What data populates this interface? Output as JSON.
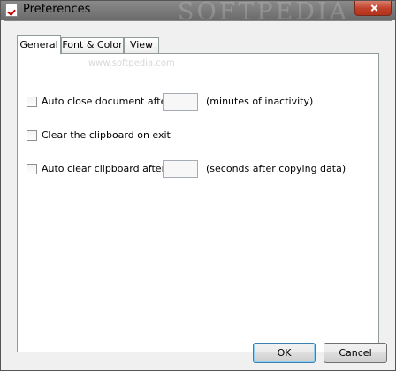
{
  "window": {
    "title": "Preferences",
    "watermark": "SOFTPEDIA"
  },
  "tabs": [
    {
      "label": "General",
      "active": true
    },
    {
      "label": "Font & Color",
      "active": false
    },
    {
      "label": "View",
      "active": false
    }
  ],
  "general": {
    "watermark_url": "www.softpedia.com",
    "auto_close": {
      "label": "Auto close document after:",
      "value": "",
      "unit": "(minutes of inactivity)",
      "checked": false
    },
    "clear_on_exit": {
      "label": "Clear the clipboard on exit",
      "checked": false
    },
    "auto_clear": {
      "label": "Auto clear clipboard after:",
      "value": "",
      "unit": "(seconds after copying data)",
      "checked": false
    }
  },
  "buttons": {
    "ok": "OK",
    "cancel": "Cancel"
  },
  "colors": {
    "titlebar": "#7a7a7a",
    "close_button": "#c0402a",
    "panel": "#ffffff",
    "dialog": "#f0f0f0"
  }
}
